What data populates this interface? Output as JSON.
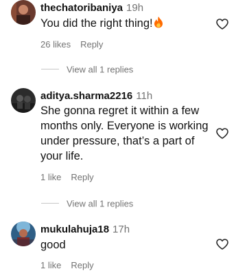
{
  "comments": [
    {
      "username": "thechatoribaniya",
      "time": "19h",
      "text": "You did the right thing!",
      "emoji": "fire-emoji",
      "likes": "26 likes",
      "reply_label": "Reply",
      "view_replies": "View all 1 replies"
    },
    {
      "username": "aditya.sharma2216",
      "time": "11h",
      "text": "She gonna regret it within a few months only. Everyone is working under pressure, that’s a part of your life.",
      "likes": "1 like",
      "reply_label": "Reply",
      "view_replies": "View all 1 replies"
    },
    {
      "username": "mukulahuja18",
      "time": "17h",
      "text": "good",
      "likes": "1 like",
      "reply_label": "Reply"
    }
  ],
  "colors": {
    "primary_text": "#111111",
    "secondary_text": "#737373",
    "divider": "#c7c7c7",
    "heart_outline": "#262626",
    "fire": "#ff6a00"
  },
  "icons": {
    "like": "heart-outline-icon",
    "emoji": "fire-emoji"
  }
}
